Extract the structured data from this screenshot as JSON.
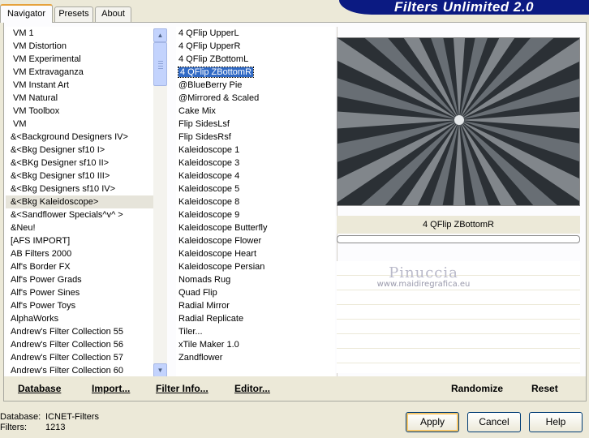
{
  "tabs": [
    {
      "label": "Navigator",
      "active": true
    },
    {
      "label": "Presets",
      "active": false
    },
    {
      "label": "About",
      "active": false
    }
  ],
  "banner_title": "Filters Unlimited 2.0",
  "categories": [
    {
      "label": "VM 1",
      "indent": true
    },
    {
      "label": "VM Distortion",
      "indent": true
    },
    {
      "label": "VM Experimental",
      "indent": true
    },
    {
      "label": "VM Extravaganza",
      "indent": true
    },
    {
      "label": "VM Instant Art",
      "indent": true
    },
    {
      "label": "VM Natural",
      "indent": true
    },
    {
      "label": "VM Toolbox",
      "indent": true
    },
    {
      "label": "VM",
      "indent": true
    },
    {
      "label": "&<Background Designers IV>"
    },
    {
      "label": "&<Bkg Designer sf10 I>"
    },
    {
      "label": "&<BKg Designer sf10 II>"
    },
    {
      "label": "&<Bkg Designer sf10 III>"
    },
    {
      "label": "&<Bkg Designers sf10 IV>"
    },
    {
      "label": "&<Bkg Kaleidoscope>",
      "selected": true
    },
    {
      "label": "&<Sandflower Specials^v^ >"
    },
    {
      "label": "&Neu!"
    },
    {
      "label": "[AFS IMPORT]"
    },
    {
      "label": "AB Filters 2000"
    },
    {
      "label": "Alf's Border FX"
    },
    {
      "label": "Alf's Power Grads"
    },
    {
      "label": "Alf's Power Sines"
    },
    {
      "label": "Alf's Power Toys"
    },
    {
      "label": "AlphaWorks"
    },
    {
      "label": "Andrew's Filter Collection 55"
    },
    {
      "label": "Andrew's Filter Collection 56"
    },
    {
      "label": "Andrew's Filter Collection 57"
    },
    {
      "label": "Andrew's Filter Collection 60"
    }
  ],
  "filters": [
    {
      "label": "4 QFlip UpperL"
    },
    {
      "label": "4 QFlip UpperR"
    },
    {
      "label": "4 QFlip ZBottomL"
    },
    {
      "label": "4 QFlip ZBottomR",
      "selected": true
    },
    {
      "label": "@BlueBerry Pie"
    },
    {
      "label": "@Mirrored & Scaled"
    },
    {
      "label": "Cake Mix"
    },
    {
      "label": "Flip SidesLsf"
    },
    {
      "label": "Flip SidesRsf"
    },
    {
      "label": "Kaleidoscope 1"
    },
    {
      "label": "Kaleidoscope 3"
    },
    {
      "label": "Kaleidoscope 4"
    },
    {
      "label": "Kaleidoscope 5"
    },
    {
      "label": "Kaleidoscope 8"
    },
    {
      "label": "Kaleidoscope 9"
    },
    {
      "label": "Kaleidoscope Butterfly"
    },
    {
      "label": "Kaleidoscope Flower"
    },
    {
      "label": "Kaleidoscope Heart"
    },
    {
      "label": "Kaleidoscope Persian"
    },
    {
      "label": "Nomads Rug"
    },
    {
      "label": "Quad Flip"
    },
    {
      "label": "Radial Mirror"
    },
    {
      "label": "Radial Replicate"
    },
    {
      "label": "Tiler..."
    },
    {
      "label": "xTile Maker 1.0"
    },
    {
      "label": "Zandflower"
    }
  ],
  "preview": {
    "caption": "4 QFlip ZBottomR",
    "progress": 0
  },
  "watermark": {
    "title": "Pinuccia",
    "url": "www.maidiregrafica.eu"
  },
  "toolbar": {
    "database": "Database",
    "import": "Import...",
    "filter_info": "Filter Info...",
    "editor": "Editor...",
    "randomize": "Randomize",
    "reset": "Reset"
  },
  "footer": {
    "database_label": "Database:",
    "database_value": "ICNET-Filters",
    "filters_label": "Filters:",
    "filters_value": "1213"
  },
  "buttons": {
    "apply": "Apply",
    "cancel": "Cancel",
    "help": "Help"
  },
  "colors": {
    "banner": "#0b1a82",
    "selection": "#316ac5",
    "window_bg": "#ece9d8"
  },
  "icons": {
    "scroll_up": "chevron-up-icon",
    "scroll_down": "chevron-down-icon"
  }
}
